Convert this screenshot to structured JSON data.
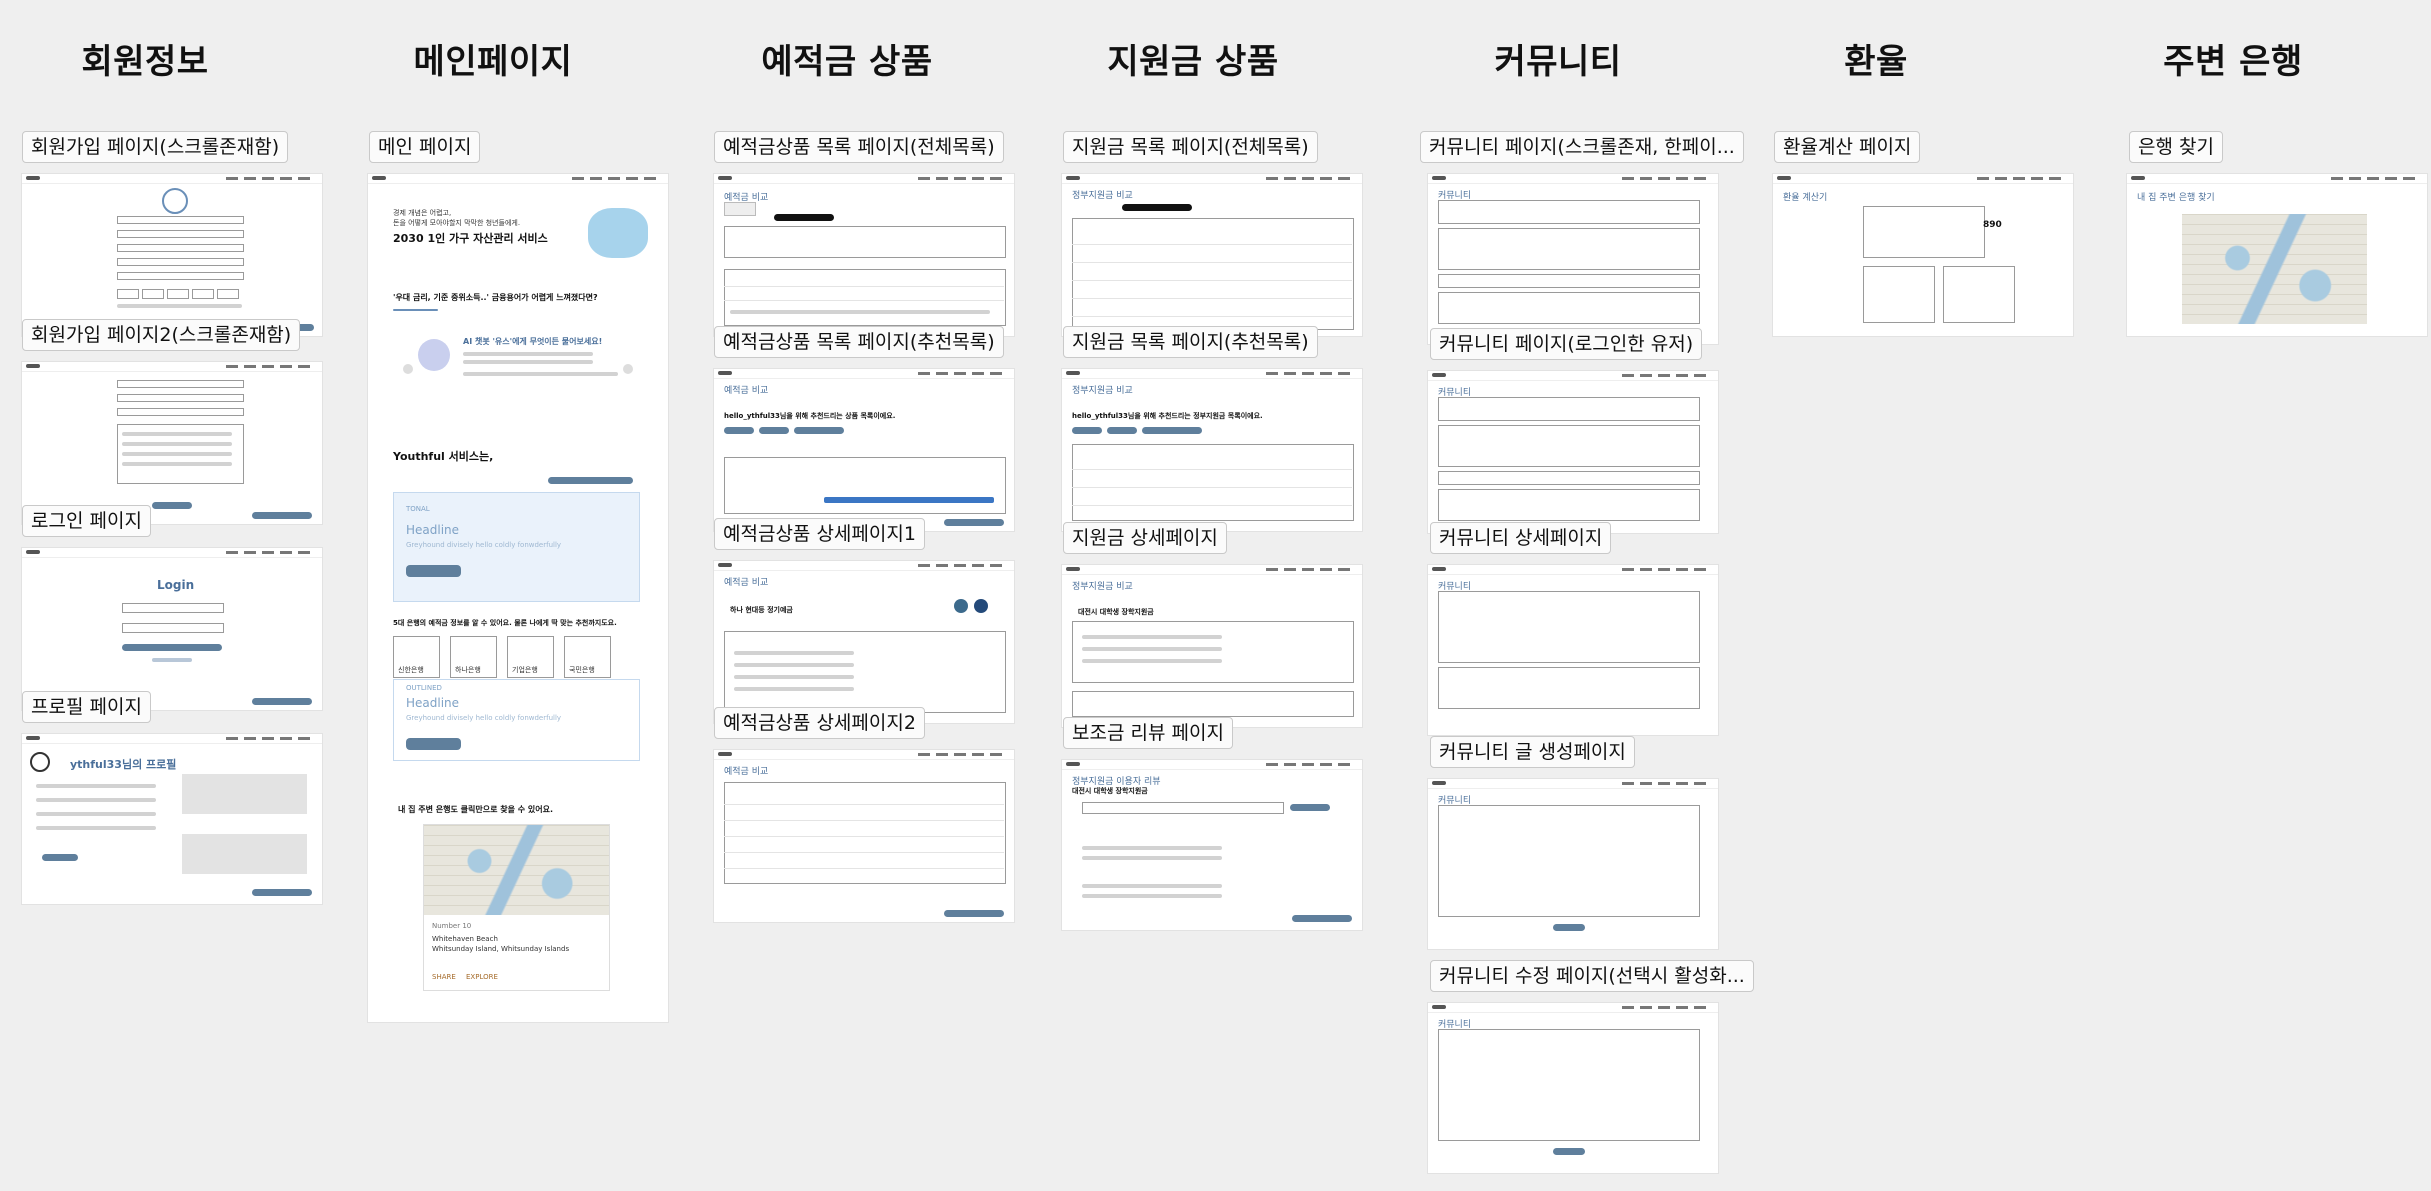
{
  "columns": [
    {
      "title": "회원정보"
    },
    {
      "title": "메인페이지"
    },
    {
      "title": "예적금 상품"
    },
    {
      "title": "지원금 상품"
    },
    {
      "title": "커뮤니티"
    },
    {
      "title": "환율"
    },
    {
      "title": "주변 은행"
    }
  ],
  "labels": {
    "signup": "회원가입 페이지(스크롤존재함)",
    "signup2": "회원가입 페이지2(스크롤존재함)",
    "login": "로그인 페이지",
    "profile": "프로필 페이지",
    "main": "메인 페이지",
    "deposit_all": "예적금상품 목록 페이지(전체목록)",
    "deposit_rec": "예적금상품 목록 페이지(추천목록)",
    "deposit_detail1": "예적금상품 상세페이지1",
    "deposit_detail2": "예적금상품 상세페이지2",
    "grant_all": "지원금 목록 페이지(전체목록)",
    "grant_rec": "지원금 목록 페이지(추천목록)",
    "grant_detail": "지원금 상세페이지",
    "grant_review": "보조금 리뷰 페이지",
    "community_scroll": "커뮤니티 페이지(스크롤존재, 한페이...",
    "community_user": "커뮤니티 페이지(로그인한 유저)",
    "community_detail": "커뮤니티 상세페이지",
    "community_create": "커뮤니티 글 생성페이지",
    "community_edit": "커뮤니티 수정 페이지(선택시 활성화...",
    "exchange": "환율계산 페이지",
    "bank": "은행 찾기"
  },
  "inner": {
    "login_title": "Login",
    "profile_title": "ythful33님의 프로필",
    "main_hero": "2030 1인 가구 자산관리 서비스",
    "main_hero_sub1": "경제 개념은 어렵고,",
    "main_hero_sub2": "돈을 어떻게 모아야할지 막막한 청년들에게.",
    "main_question": "'우대 금리, 기준 중위소득..' 금융용어가 어렵게 느껴졌다면?",
    "main_ai": "AI 챗봇 '유스'에게 무엇이든 물어보세요!",
    "main_service": "Youthful 서비스는,",
    "main_tonal": "TONAL",
    "main_headline": "Headline",
    "main_headline_sub": "Greyhound divisely hello coldly fonwderfully",
    "main_outlined": "OUTLINED",
    "main_headline2": "Headline",
    "main_banks_text": "5대 은행의 예적금 정보를 알 수 있어요. 물론 나에게 딱 맞는 추천까지도요.",
    "banks": [
      "신한은행",
      "하나은행",
      "기업은행",
      "국민은행"
    ],
    "main_map_text": "내 집 주변 은행도 클릭만으로 찾을 수 있어요.",
    "main_card_num": "Number 10",
    "main_card_title1": "Whitehaven Beach",
    "main_card_title2": "Whitsunday Island, Whitsunday Islands",
    "main_share": "SHARE",
    "main_explore": "EXPLORE",
    "deposit_title": "예적금 비교",
    "grant_title": "정부지원금 비교",
    "rec_text": "hello_ythful33님을 위해 추천드리는 상품 목록이에요.",
    "grant_rec_text": "hello_ythful33님을 위해 추천드리는 정부지원금 목록이에요.",
    "deposit_detail_name": "하나 현대등 정기예금",
    "grant_detail_name": "대전시 대학생 장학지원금",
    "grant_review_title": "정부지원금 이용자 리뷰",
    "grant_review_name": "대전시 대학생 장학지원금",
    "community_title": "커뮤니티",
    "exchange_title": "환율 계산기",
    "exchange_value": "890",
    "bank_title": "내 집 주변 은행 찾기"
  }
}
